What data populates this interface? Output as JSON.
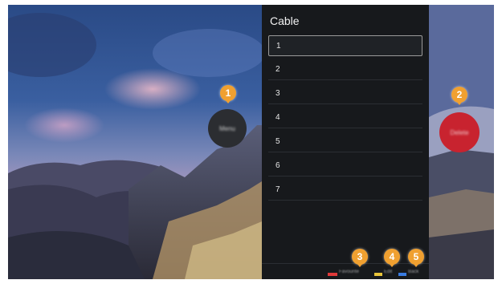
{
  "panel": {
    "title": "Cable",
    "channels": [
      "1",
      "2",
      "3",
      "4",
      "5",
      "6",
      "7"
    ],
    "selected_index": 0
  },
  "menu_orb": {
    "label": "Menu",
    "color": "#2b2d31"
  },
  "delete_orb": {
    "label": "Delete",
    "color": "#c8232f"
  },
  "color_keys": [
    {
      "name": "red-key",
      "color": "#e03a3a",
      "label": "Favourite"
    },
    {
      "name": "yellow-key",
      "color": "#e8c43a",
      "label": "Edit"
    },
    {
      "name": "blue-key",
      "color": "#3a7be0",
      "label": "Back"
    }
  ],
  "callouts": {
    "accent": "#f0a030",
    "labels": [
      "1",
      "2",
      "3",
      "4",
      "5"
    ]
  },
  "backdrop": {
    "description_icon": "mountain-night-sky-wallpaper"
  }
}
